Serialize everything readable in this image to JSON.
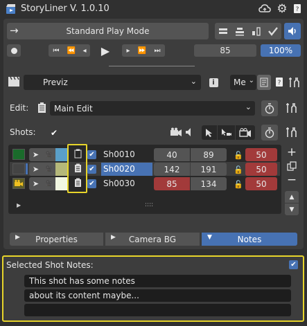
{
  "header": {
    "title": "StoryLiner",
    "version": "V. 1.0.10"
  },
  "play": {
    "mode_label": "Standard Play Mode",
    "frame": "85",
    "zoom": "100%"
  },
  "take": {
    "name": "Previz",
    "me_label": "Me"
  },
  "edit": {
    "label": "Edit:",
    "name": "Main Edit"
  },
  "shots": {
    "label": "Shots:",
    "rows": [
      {
        "name": "Sh0010",
        "start": "40",
        "end": "89",
        "duration": "50",
        "color": "#1a6b2b",
        "swatch": "#5a9fc8"
      },
      {
        "name": "Sh0020",
        "start": "142",
        "end": "191",
        "duration": "50",
        "color": "#444444",
        "swatch": "#b5b87a"
      },
      {
        "name": "Sh0030",
        "start": "85",
        "end": "134",
        "duration": "50",
        "color": "#5d5d2a",
        "swatch": "#f2f7e2"
      }
    ],
    "dots": "::::"
  },
  "tabs": [
    "Properties",
    "Camera BG",
    "Notes"
  ],
  "notes": {
    "label": "Selected Shot Notes:",
    "lines": [
      "This shot has some notes",
      "about its content maybe...",
      ""
    ]
  },
  "colors": {
    "accent": "#4772b3",
    "warning": "#a23a3a",
    "highlight": "#e8d52a"
  }
}
